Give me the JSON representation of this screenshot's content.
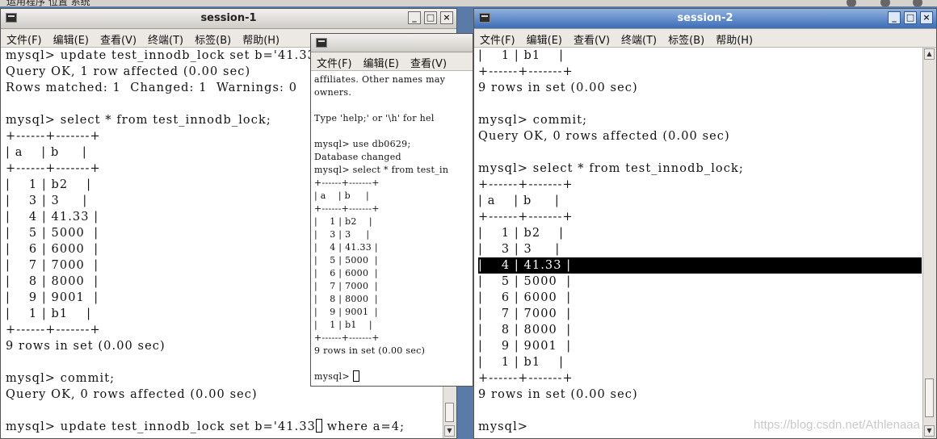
{
  "desktop": {
    "top_text": "运用程序  位置  系统"
  },
  "session1": {
    "title": "session-1",
    "menu": [
      "文件(F)",
      "编辑(E)",
      "查看(V)",
      "终端(T)",
      "标签(B)",
      "帮助(H)"
    ],
    "lines": [
      "mysql> update test_innodb_lock set b='41.33",
      "Query OK, 1 row affected (0.00 sec)",
      "Rows matched: 1  Changed: 1  Warnings: 0",
      "",
      "mysql> select * from test_innodb_lock;",
      "+------+-------+",
      "| a    | b     |",
      "+------+-------+",
      "|    1 | b2    |",
      "|    3 | 3     |",
      "|    4 | 41.33 |",
      "|    5 | 5000  |",
      "|    6 | 6000  |",
      "|    7 | 7000  |",
      "|    8 | 8000  |",
      "|    9 | 9001  |",
      "|    1 | b1    |",
      "+------+-------+",
      "9 rows in set (0.00 sec)",
      "",
      "mysql> commit;",
      "Query OK, 0 rows affected (0.00 sec)",
      ""
    ],
    "last_line_before_cursor": "mysql> update test_innodb_lock set b='41.33",
    "last_line_after_cursor": " where a=4;"
  },
  "session3": {
    "menu": [
      "文件(F)",
      "编辑(E)",
      "查看(V)",
      "终端"
    ],
    "lines": [
      "affiliates. Other names may",
      "owners.",
      "",
      "Type 'help;' or '\\h' for hel",
      "",
      "mysql> use db0629;",
      "Database changed",
      "mysql> select * from test_in",
      "+------+-------+",
      "| a    | b     |",
      "+------+-------+",
      "|    1 | b2    |",
      "|    3 | 3     |",
      "|    4 | 41.33 |",
      "|    5 | 5000  |",
      "|    6 | 6000  |",
      "|    7 | 7000  |",
      "|    8 | 8000  |",
      "|    9 | 9001  |",
      "|    1 | b1    |",
      "+------+-------+",
      "9 rows in set (0.00 sec)",
      ""
    ],
    "prompt": "mysql> "
  },
  "session2": {
    "title": "session-2",
    "menu": [
      "文件(F)",
      "编辑(E)",
      "查看(V)",
      "终端(T)",
      "标签(B)",
      "帮助(H)"
    ],
    "lines_before": [
      "|    1 | b1    |",
      "+------+-------+",
      "9 rows in set (0.00 sec)",
      "",
      "mysql> commit;",
      "Query OK, 0 rows affected (0.00 sec)",
      "",
      "mysql> select * from test_innodb_lock;",
      "+------+-------+",
      "| a    | b     |",
      "+------+-------+",
      "|    1 | b2    |",
      "|    3 | 3     |"
    ],
    "highlighted_line": "|    4 | 41.33 |",
    "lines_after": [
      "|    5 | 5000  |",
      "|    6 | 6000  |",
      "|    7 | 7000  |",
      "|    8 | 8000  |",
      "|    9 | 9001  |",
      "|    1 | b1    |",
      "+------+-------+",
      "9 rows in set (0.00 sec)",
      "",
      "mysql> "
    ],
    "watermark": "https://blog.csdn.net/Athlenaaa"
  }
}
